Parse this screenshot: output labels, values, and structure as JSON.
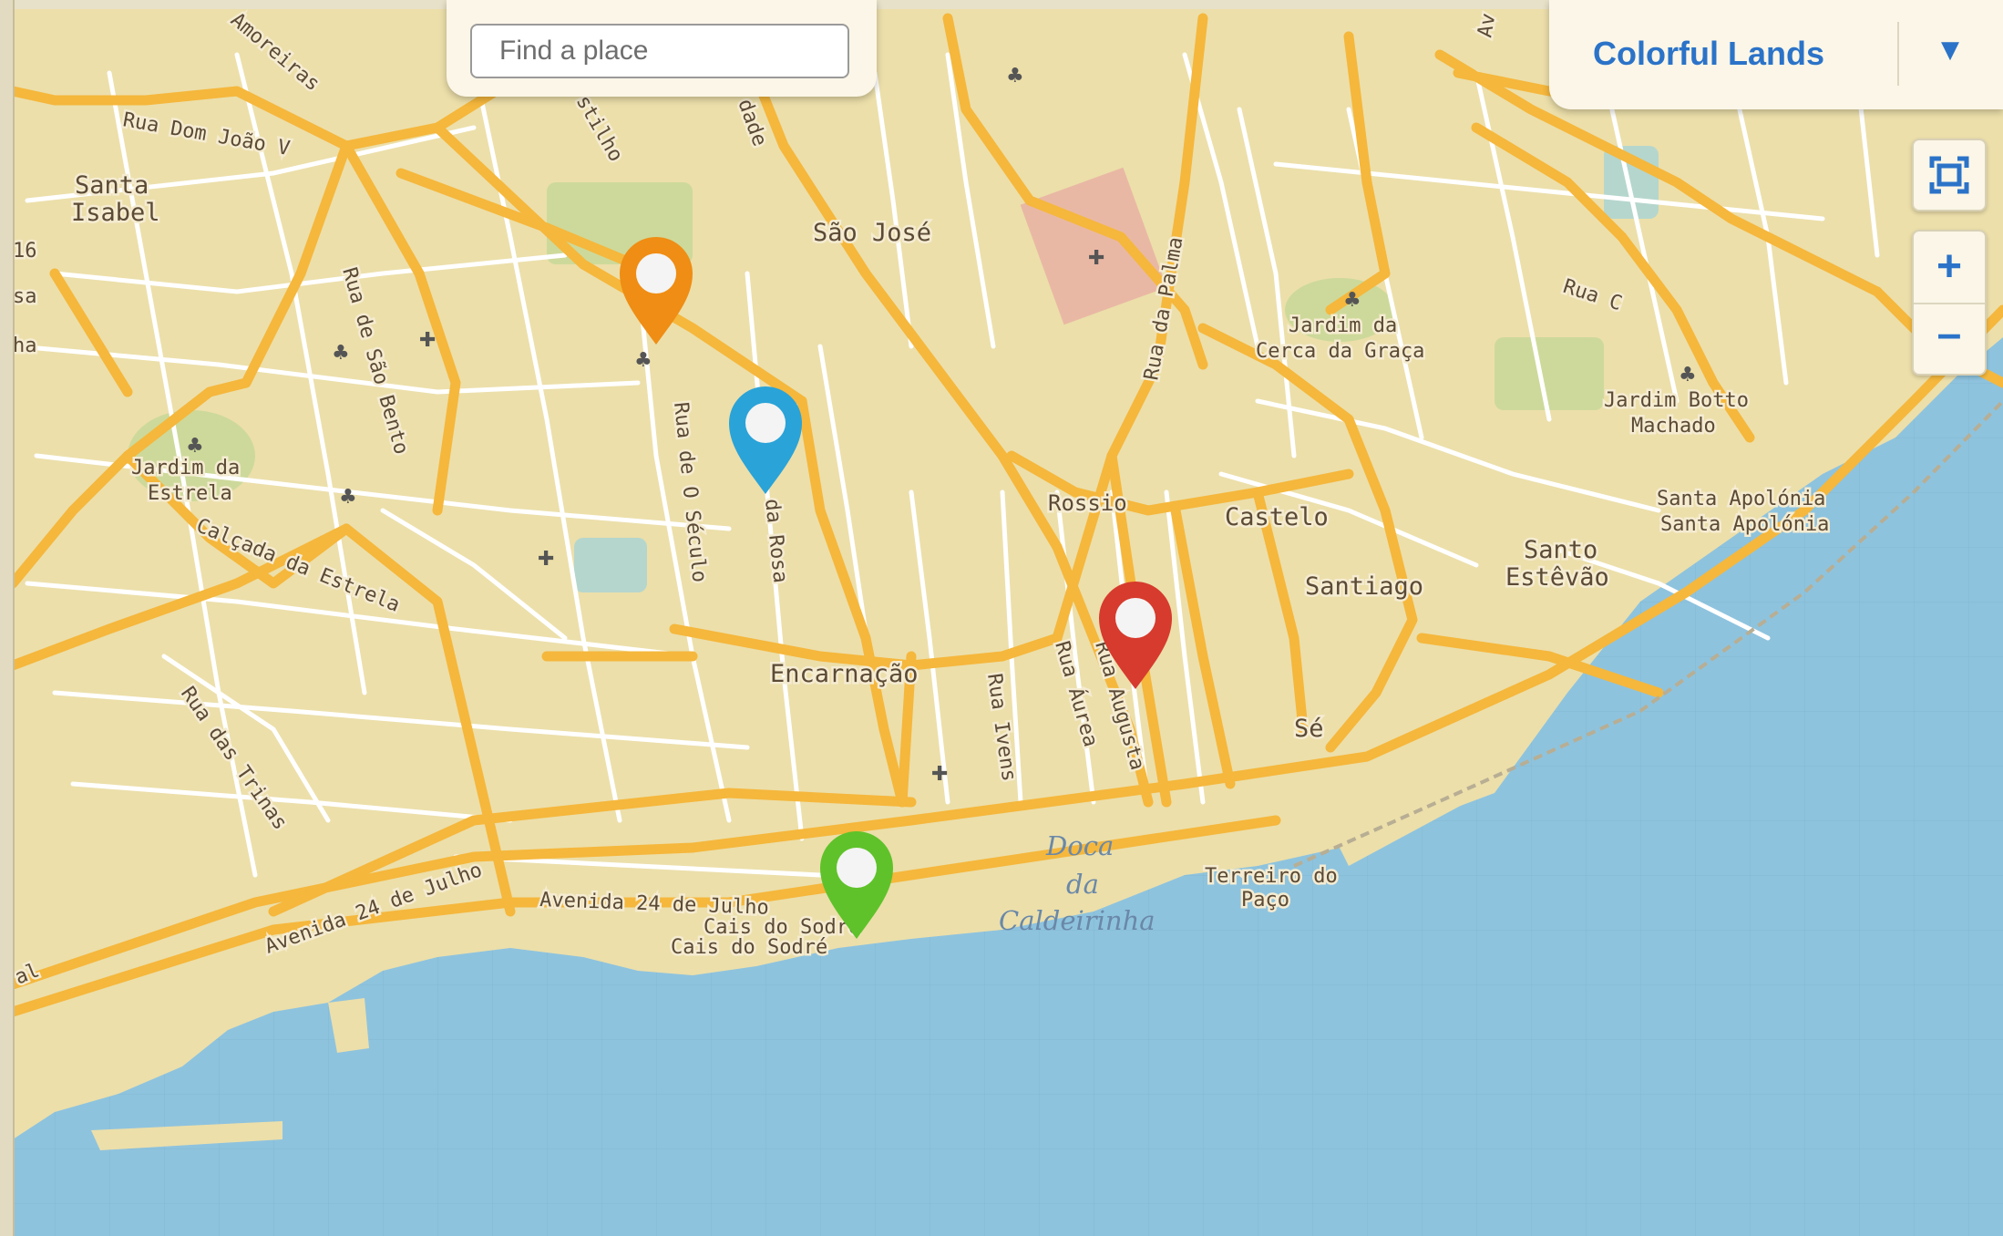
{
  "search": {
    "placeholder": "Find a place"
  },
  "theme_selector": {
    "selected": "Colorful Lands",
    "dropdown_icon": "triangle-down-icon"
  },
  "controls": {
    "fullscreen_icon": "fullscreen-icon",
    "zoom_in_label": "+",
    "zoom_out_label": "–"
  },
  "colors": {
    "land": "#ecdfaa",
    "water": "#8ec3de",
    "major_road": "#f5b73c",
    "minor_road": "#ffffff",
    "park": "#cdd99a",
    "accent": "#2b73c8"
  },
  "map_labels": {
    "neighbourhoods": [
      "Santa Isabel",
      "São José",
      "Encarnação",
      "Rossio",
      "Castelo",
      "Santiago",
      "Santo Estêvão",
      "Sé"
    ],
    "santa_isabel_1": "Santa",
    "santa_isabel_2": "Isabel",
    "santo_estevao_1": "Santo",
    "santo_estevao_2": "Estêvão",
    "streets": {
      "amoreiras": "Amoreiras",
      "dom_joao_v": "Rua Dom João V",
      "sao_bento": "Rua de São Bento",
      "calcada_estrela": "Calçada da Estrela",
      "trinas": "Rua das Trinas",
      "seculo": "Rua de O Século",
      "rosa": "da Rosa",
      "palma": "Rua da Palma",
      "ivens": "Rua Ivens",
      "aurea": "Rua Áurea",
      "augusta": "Rua Augusta",
      "av24_1": "Avenida 24 de Julho",
      "av24_2": "Avenida 24 de Julho",
      "rua_c": "Rua C",
      "castilho": "stilho",
      "liberdade": "dade",
      "av_top": "Av"
    },
    "parks": {
      "estrela_1": "Jardim da",
      "estrela_2": "Estrela",
      "graca_1": "Jardim da",
      "graca_2": "Cerca da Graça",
      "botto_1": "Jardim Botto",
      "botto_2": "Machado"
    },
    "places": {
      "santa_apolonia_1": "Santa Apolónia",
      "santa_apolonia_2": "Santa Apolónia",
      "cais_sodre_1": "Cais do Sodré",
      "cais_sodre_2": "Cais do Sodré",
      "terreiro_1": "Terreiro do",
      "terreiro_2": "Paço"
    },
    "water": {
      "doca_1": "Doca",
      "doca_2": "da",
      "doca_3": "Caldeirinha"
    },
    "edge_fragments": {
      "f1": "16",
      "f2": "sa",
      "f3": "ha",
      "f4": "al"
    }
  },
  "markers": [
    {
      "name": "orange",
      "color": "#ef8d14"
    },
    {
      "name": "blue",
      "color": "#2aa3d8"
    },
    {
      "name": "red",
      "color": "#d63b2d"
    },
    {
      "name": "green",
      "color": "#5fc22a"
    }
  ]
}
